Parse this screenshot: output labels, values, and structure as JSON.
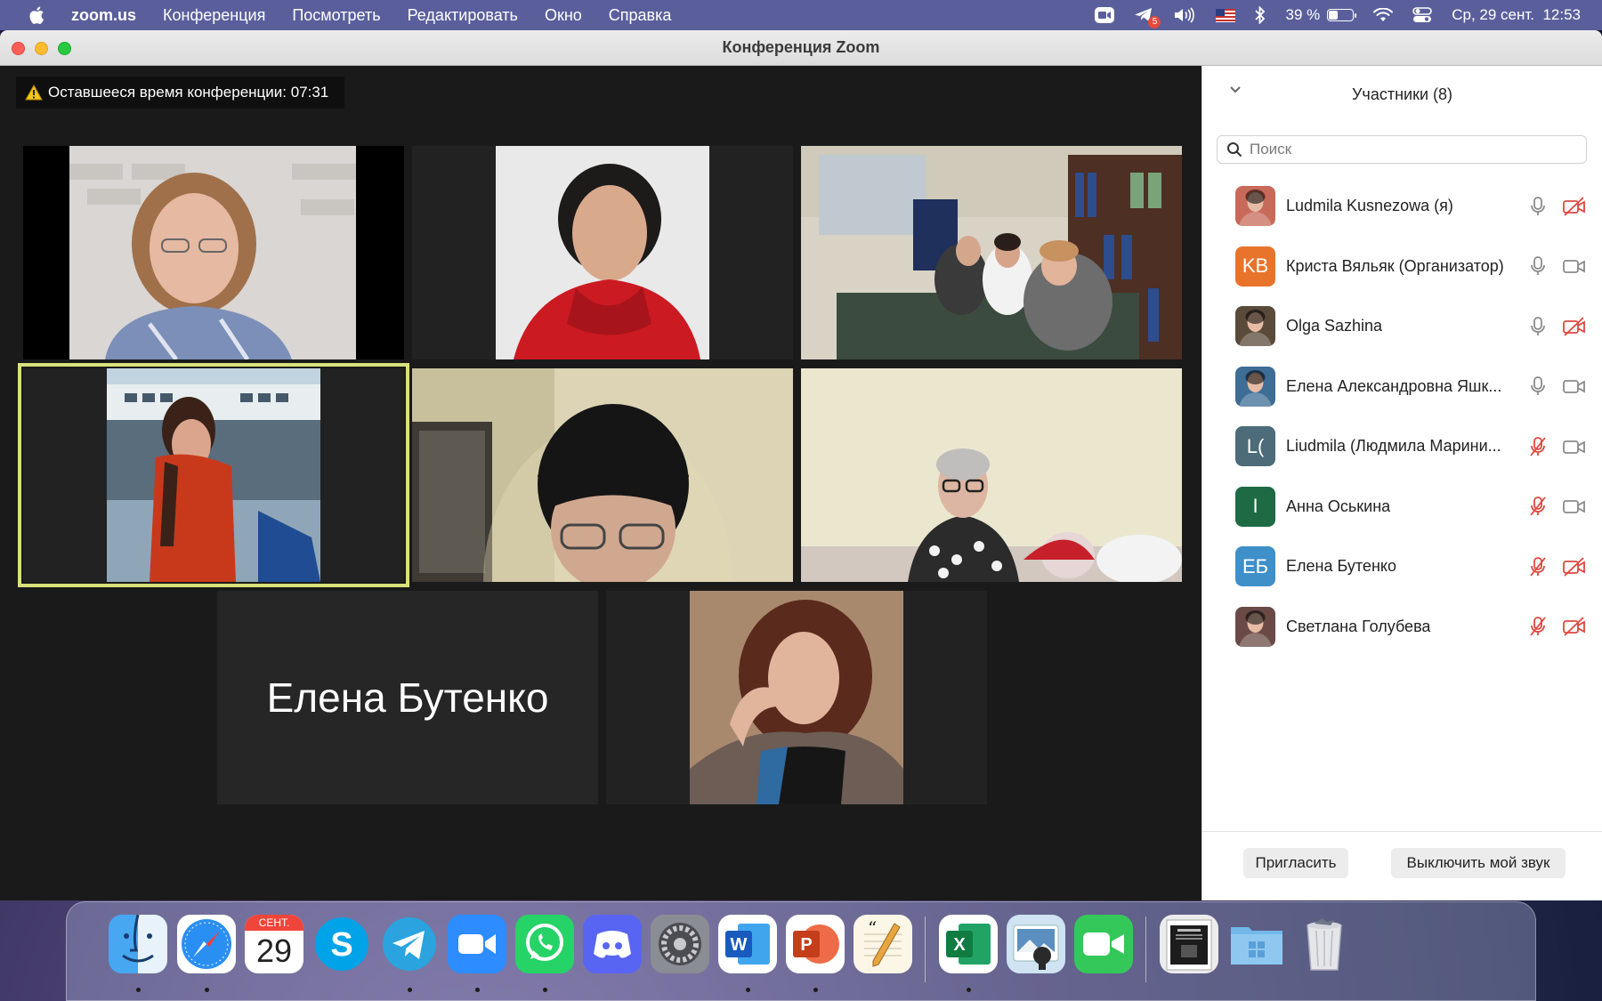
{
  "menubar": {
    "app_name": "zoom.us",
    "items": [
      "Конференция",
      "Посмотреть",
      "Редактировать",
      "Окно",
      "Справка"
    ],
    "telegram_badge": "5",
    "battery_text": "39 %",
    "battery_level": 0.39,
    "datetime": "Ср, 29 сент.  12:53"
  },
  "window": {
    "title": "Конференция Zoom"
  },
  "meeting": {
    "time_banner": "Оставшееся время конференции: 07:31",
    "name_only_tile": "Елена Бутенко"
  },
  "participants": {
    "header": "Участники (8)",
    "search_placeholder": "Поиск",
    "list": [
      {
        "name": "Ludmila Kusnezowa (я)",
        "initials": "",
        "avatar_color": "#c86a5a",
        "mic": "on",
        "cam": "off"
      },
      {
        "name": "Криста Вяльяк  (Организатор)",
        "initials": "KB",
        "avatar_color": "#e8742b",
        "mic": "on",
        "cam": "on"
      },
      {
        "name": "Olga Sazhina",
        "initials": "",
        "avatar_color": "#5a4a3a",
        "mic": "on",
        "cam": "off"
      },
      {
        "name": "Елена Александровна Яшк...",
        "initials": "",
        "avatar_color": "#3e6d96",
        "mic": "on",
        "cam": "on"
      },
      {
        "name": "Liudmila (Людмила Марини...",
        "initials": "L(",
        "avatar_color": "#4d6b78",
        "mic": "off",
        "cam": "on"
      },
      {
        "name": "Анна Оськина",
        "initials": "I",
        "avatar_color": "#1e6a45",
        "mic": "off",
        "cam": "on"
      },
      {
        "name": "Елена Бутенко",
        "initials": "ЕБ",
        "avatar_color": "#3f8fc9",
        "mic": "off",
        "cam": "off"
      },
      {
        "name": "Светлана Голубева",
        "initials": "",
        "avatar_color": "#6a4a46",
        "mic": "off",
        "cam": "off"
      }
    ]
  },
  "footer": {
    "invite_label": "Пригласить",
    "mute_me_label": "Выключить мой звук"
  },
  "dock": {
    "calendar_month": "СЕНТ.",
    "calendar_day": "29",
    "apps": [
      "finder",
      "safari",
      "calendar",
      "skype",
      "telegram",
      "zoom",
      "whatsapp",
      "discord",
      "system-preferences",
      "word",
      "powerpoint",
      "textedit",
      "excel",
      "preview",
      "facetime",
      "document-folder",
      "windows-folder",
      "trash"
    ]
  }
}
